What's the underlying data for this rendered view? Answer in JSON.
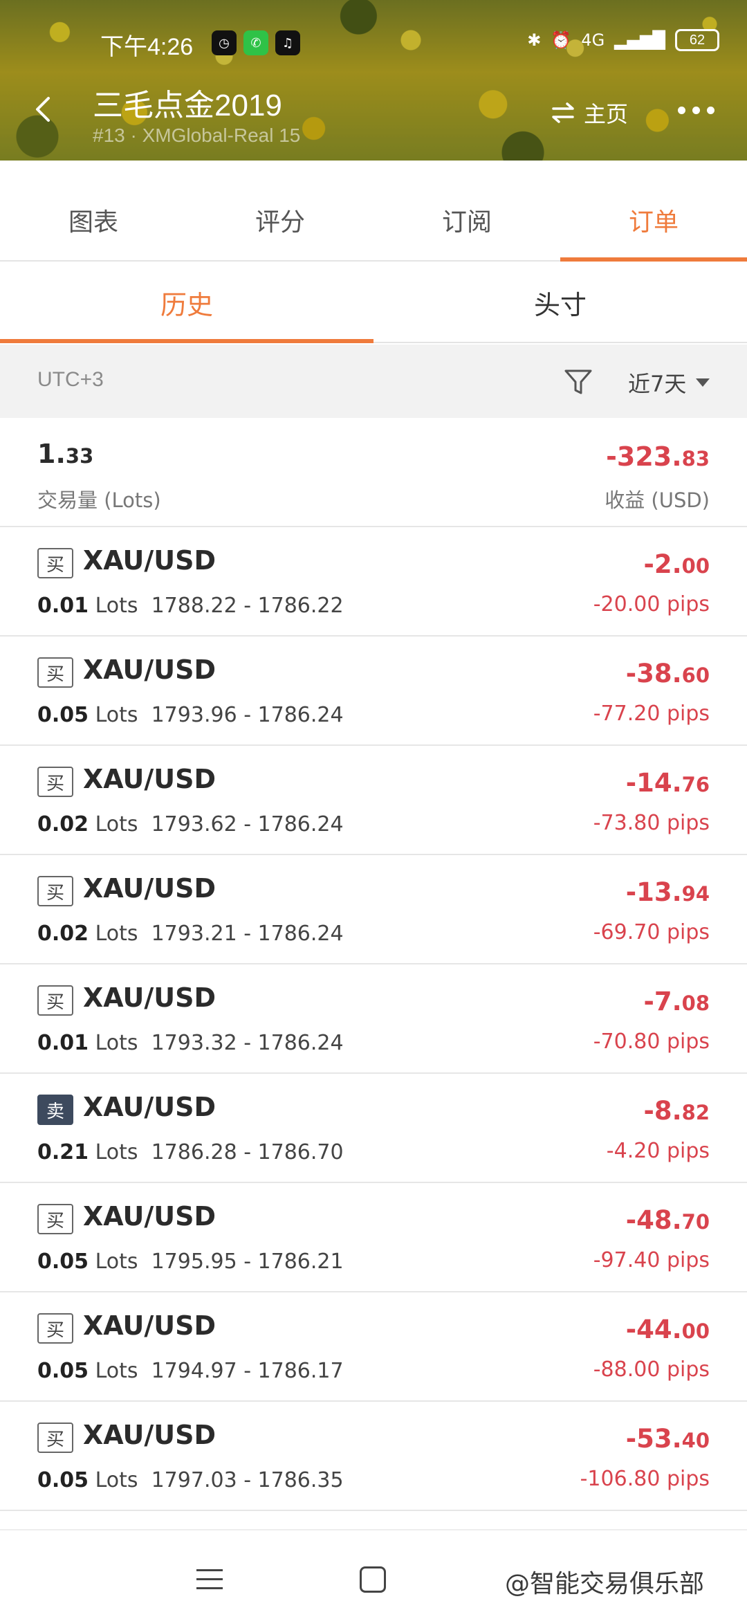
{
  "status_bar": {
    "time": "下午4:26",
    "battery": "62",
    "network": "4G"
  },
  "header": {
    "title": "三毛点金2019",
    "subtitle": "#13 · XMGlobal-Real 15",
    "home_label": "主页"
  },
  "main_tabs": [
    {
      "label": "图表"
    },
    {
      "label": "评分"
    },
    {
      "label": "订阅"
    },
    {
      "label": "订单"
    }
  ],
  "sub_tabs": [
    {
      "label": "历史"
    },
    {
      "label": "头寸"
    }
  ],
  "filter": {
    "timezone": "UTC+3",
    "period": "近7天"
  },
  "summary": {
    "volume_int": "1.",
    "volume_dec": "33",
    "volume_label": "交易量 (Lots)",
    "profit_int": "-323.",
    "profit_dec": "83",
    "profit_label": "收益 (USD)"
  },
  "orders": [
    {
      "side": "买",
      "symbol": "XAU/USD",
      "lots": "0.01",
      "lots_unit": "Lots",
      "prices": "1788.22 - 1786.22",
      "profit_int": "-2.",
      "profit_dec": "00",
      "pips": "-20.00 pips"
    },
    {
      "side": "买",
      "symbol": "XAU/USD",
      "lots": "0.05",
      "lots_unit": "Lots",
      "prices": "1793.96 - 1786.24",
      "profit_int": "-38.",
      "profit_dec": "60",
      "pips": "-77.20 pips"
    },
    {
      "side": "买",
      "symbol": "XAU/USD",
      "lots": "0.02",
      "lots_unit": "Lots",
      "prices": "1793.62 - 1786.24",
      "profit_int": "-14.",
      "profit_dec": "76",
      "pips": "-73.80 pips"
    },
    {
      "side": "买",
      "symbol": "XAU/USD",
      "lots": "0.02",
      "lots_unit": "Lots",
      "prices": "1793.21 - 1786.24",
      "profit_int": "-13.",
      "profit_dec": "94",
      "pips": "-69.70 pips"
    },
    {
      "side": "买",
      "symbol": "XAU/USD",
      "lots": "0.01",
      "lots_unit": "Lots",
      "prices": "1793.32 - 1786.24",
      "profit_int": "-7.",
      "profit_dec": "08",
      "pips": "-70.80 pips"
    },
    {
      "side": "卖",
      "symbol": "XAU/USD",
      "lots": "0.21",
      "lots_unit": "Lots",
      "prices": "1786.28 - 1786.70",
      "profit_int": "-8.",
      "profit_dec": "82",
      "pips": "-4.20 pips"
    },
    {
      "side": "买",
      "symbol": "XAU/USD",
      "lots": "0.05",
      "lots_unit": "Lots",
      "prices": "1795.95 - 1786.21",
      "profit_int": "-48.",
      "profit_dec": "70",
      "pips": "-97.40 pips"
    },
    {
      "side": "买",
      "symbol": "XAU/USD",
      "lots": "0.05",
      "lots_unit": "Lots",
      "prices": "1794.97 - 1786.17",
      "profit_int": "-44.",
      "profit_dec": "00",
      "pips": "-88.00 pips"
    },
    {
      "side": "买",
      "symbol": "XAU/USD",
      "lots": "0.05",
      "lots_unit": "Lots",
      "prices": "1797.03 - 1786.35",
      "profit_int": "-53.",
      "profit_dec": "40",
      "pips": "-106.80 pips"
    }
  ],
  "watermark": "@智能交易俱乐部",
  "colors": {
    "accent": "#ef7b3c",
    "loss": "#d9434d",
    "sell_badge": "#3d4a5e"
  }
}
